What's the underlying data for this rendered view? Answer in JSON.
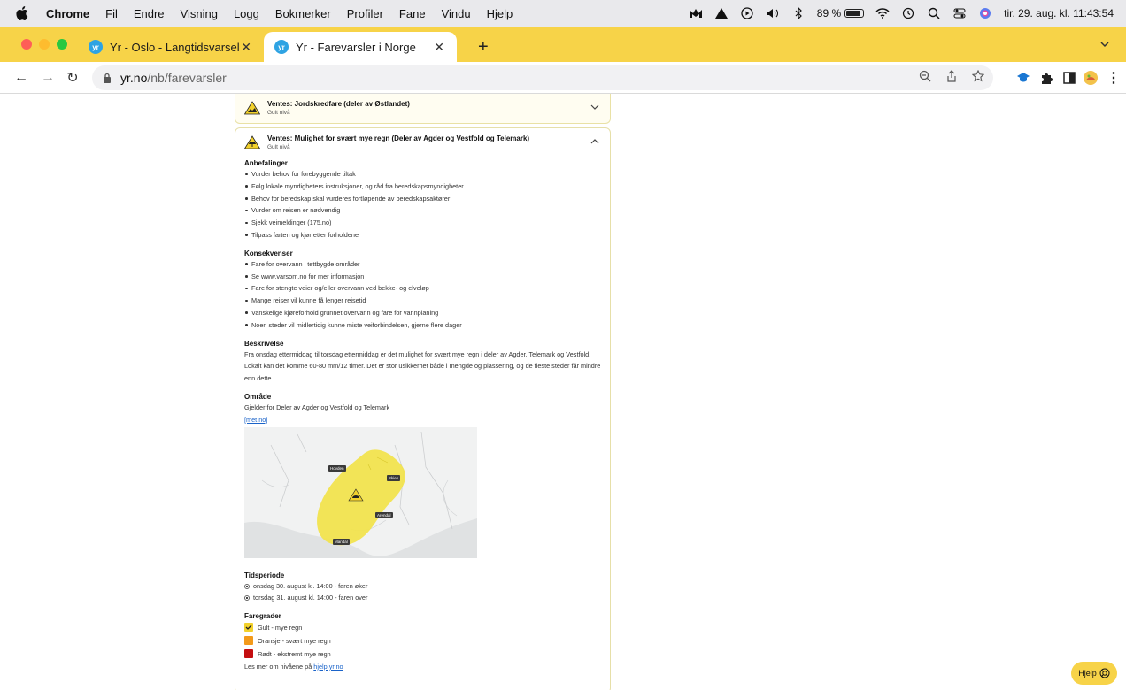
{
  "menubar": {
    "app": "Chrome",
    "menus": [
      "Fil",
      "Endre",
      "Visning",
      "Logg",
      "Bokmerker",
      "Profiler",
      "Fane",
      "Vindu",
      "Hjelp"
    ],
    "battery": "89 %",
    "datetime": "tir. 29. aug. kl. 11:43:54"
  },
  "tabs": [
    {
      "title": "Yr - Oslo - Langtidsvarsel",
      "active": false
    },
    {
      "title": "Yr - Farevarsler i Norge",
      "active": true
    }
  ],
  "address": {
    "domain": "yr.no",
    "path": "/nb/farevarsler"
  },
  "warnings": [
    {
      "title": "Ventes: Jordskredfare (deler av Østlandet)",
      "level": "Gult nivå",
      "expanded": false
    },
    {
      "title": "Ventes: Mulighet for svært mye regn (Deler av Agder og Vestfold og Telemark)",
      "level": "Gult nivå",
      "expanded": true
    }
  ],
  "detail": {
    "recommendations_heading": "Anbefalinger",
    "recommendations": [
      "Vurder behov for forebyggende tiltak",
      "Følg lokale myndigheters instruksjoner, og råd fra beredskapsmyndigheter",
      "Behov for beredskap skal vurderes fortløpende av beredskapsaktører",
      "Vurder om reisen er nødvendig",
      "Sjekk veimeldinger (175.no)",
      "Tilpass farten og kjør etter forholdene"
    ],
    "consequences_heading": "Konsekvenser",
    "consequences": [
      "Fare for overvann i tettbygde områder",
      "Se www.varsom.no for mer informasjon",
      "Fare for stengte veier og/eller overvann ved bekke- og elveløp",
      "Mange reiser vil kunne få lenger reisetid",
      "Vanskelige kjøreforhold grunnet overvann og fare for vannplaning",
      "Noen steder vil midlertidig kunne miste veiforbindelsen, gjerne flere dager"
    ],
    "description_heading": "Beskrivelse",
    "description": "Fra onsdag ettermiddag til torsdag ettermiddag er det mulighet for svært mye regn i deler av Agder, Telemark og Vestfold. Lokalt kan det komme 60-80 mm/12 timer. Det er stor usikkerhet både i mengde og plassering, og de fleste steder får mindre enn dette.",
    "area_heading": "Område",
    "area_text": "Gjelder for Deler av Agder og Vestfold og Telemark",
    "source_link": "[met.no]",
    "map_labels": [
      "Hovden",
      "Skien",
      "Arendal",
      "Mandal"
    ],
    "period_heading": "Tidsperiode",
    "period": [
      "onsdag 30. august kl. 14:00 - faren øker",
      "torsdag 31. august kl. 14:00 - faren over"
    ],
    "levels_heading": "Faregrader",
    "levels": [
      {
        "label": "Gult - mye regn",
        "color": "#f2d12c",
        "selected": true
      },
      {
        "label": "Oransje - svært mye regn",
        "color": "#f39a1a",
        "selected": false
      },
      {
        "label": "Rødt - ekstremt mye regn",
        "color": "#c40e10",
        "selected": false
      }
    ],
    "more_prefix": "Les mer om nivåene på",
    "more_link": "hjelp.yr.no"
  },
  "help_button": "Hjelp",
  "colors": {
    "accent": "#f7d348",
    "link": "#1a63c9",
    "warning_yellow": "#f2d12c"
  }
}
